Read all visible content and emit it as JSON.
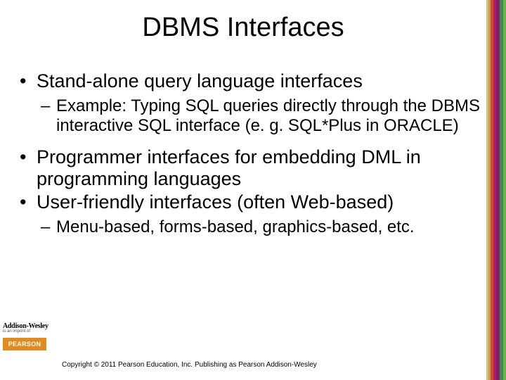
{
  "title": "DBMS Interfaces",
  "bullets": {
    "b1": "Stand-alone query language interfaces",
    "b1a": "Example: Typing SQL queries directly through the DBMS interactive SQL interface (e. g. SQL*Plus in ORACLE)",
    "b2": "Programmer interfaces for embedding DML in programming languages",
    "b3": "User-friendly interfaces (often Web-based)",
    "b3a": "Menu-based, forms-based, graphics-based, etc."
  },
  "footer": {
    "aw": "Addison-Wesley",
    "aw_sub": "is an imprint of",
    "pearson": "PEARSON",
    "copyright": "Copyright © 2011 Pearson Education, Inc. Publishing as Pearson Addison-Wesley"
  }
}
